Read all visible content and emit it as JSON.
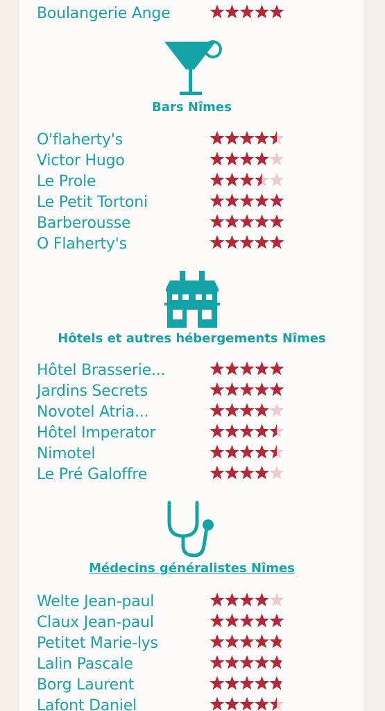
{
  "colors": {
    "accent": "#16a3a8",
    "star_full": "#b22a3a",
    "star_empty": "#eccbd0",
    "background": "#f3eeea",
    "card": "#fdfbfa"
  },
  "top_item": {
    "name": "Boulangerie Ange",
    "rating": 5
  },
  "sections": [
    {
      "icon": "cocktail-glass-icon",
      "title": "Bars Nîmes",
      "items": [
        {
          "name": "O'flaherty's",
          "rating": 4.5
        },
        {
          "name": "Victor Hugo",
          "rating": 4
        },
        {
          "name": "Le Prole",
          "rating": 3.5
        },
        {
          "name": "Le Petit Tortoni",
          "rating": 5
        },
        {
          "name": "Barberousse",
          "rating": 5
        },
        {
          "name": "O Flaherty's",
          "rating": 5
        }
      ]
    },
    {
      "icon": "hotel-building-icon",
      "title": "Hôtels et autres hébergements Nîmes",
      "items": [
        {
          "name": "Hôtel Brasserie...",
          "rating": 5
        },
        {
          "name": "Jardins Secrets",
          "rating": 5
        },
        {
          "name": "Novotel Atria...",
          "rating": 4
        },
        {
          "name": "Hôtel Imperator",
          "rating": 4.5
        },
        {
          "name": "Nimotel",
          "rating": 4.5
        },
        {
          "name": "Le Pré Galoffre",
          "rating": 4
        }
      ]
    },
    {
      "icon": "stethoscope-icon",
      "title": "Médecins généralistes Nîmes",
      "items": [
        {
          "name": "Welte Jean-paul",
          "rating": 4
        },
        {
          "name": "Claux Jean-paul",
          "rating": 5
        },
        {
          "name": "Petitet Marie-lys",
          "rating": 4.8
        },
        {
          "name": "Lalin Pascale",
          "rating": 4.8
        },
        {
          "name": "Borg Laurent",
          "rating": 4.8
        },
        {
          "name": "Lafont Daniel",
          "rating": 4.5
        }
      ]
    }
  ]
}
